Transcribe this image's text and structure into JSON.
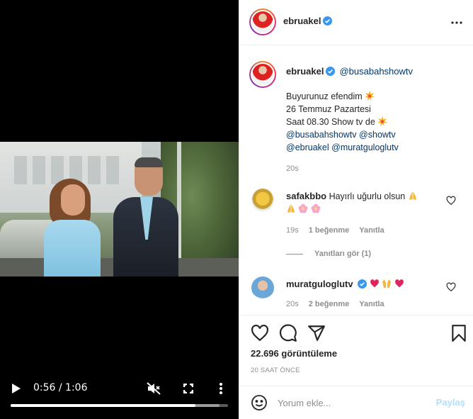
{
  "video": {
    "time": "0:56 / 1:06",
    "progress": 0.85,
    "buffered": 0.96
  },
  "header": {
    "username": "ebruakel",
    "verified": true
  },
  "caption": {
    "username": "ebruakel",
    "tag": "@busabahshowtv",
    "lines": {
      "l1": "Buyurunuz efendim",
      "l2": "26 Temmuz Pazartesi",
      "l3": "Saat 08.30 Show tv de",
      "l4a": "@busabahshowtv",
      "l4b": "@showtv",
      "l5a": "@ebruakel",
      "l5b": "@muratguloglutv"
    },
    "age": "20s"
  },
  "comments": [
    {
      "username": "safakbbo",
      "text": "Hayırlı uğurlu olsun",
      "age": "19s",
      "likes": "1 beğenme",
      "reply": "Yanıtla",
      "view_replies": "Yanıtları gör (1)"
    },
    {
      "username": "muratguloglutv",
      "verified": true,
      "age": "20s",
      "likes": "2 beğenme",
      "reply": "Yanıtla"
    }
  ],
  "stats": {
    "views": "22.696 görüntüleme",
    "time_ago": "20 SAAT ÖNCE"
  },
  "comment_box": {
    "placeholder": "Yorum ekle...",
    "post_label": "Paylaş"
  },
  "colors": {
    "verified": "#3897f0",
    "mention": "#00376b",
    "post_disabled": "#b2dffc"
  }
}
